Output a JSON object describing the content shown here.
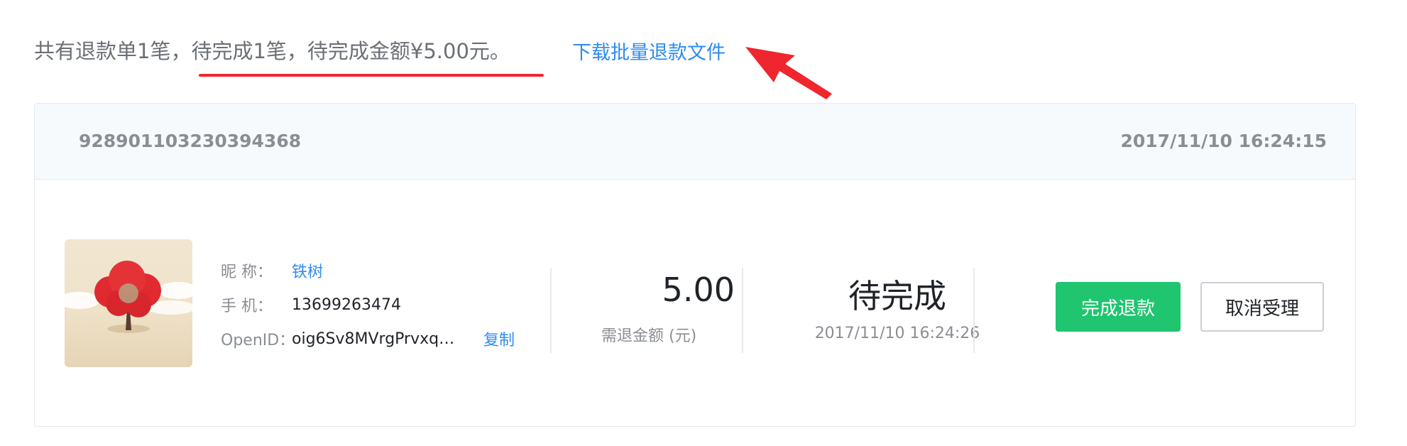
{
  "summary": {
    "prefix": "共有退款单1笔，",
    "highlight": "待完成1笔，待完成金额¥5.00元。",
    "download_link": "下载批量退款文件"
  },
  "order": {
    "order_no": "928901103230394368",
    "created_time": "2017/11/10 16:24:15",
    "user": {
      "nick_label": "昵    称：",
      "nick_value": "铁树",
      "phone_label": "手    机：",
      "phone_value": "13699263474",
      "openid_label": "OpenID：",
      "openid_value": "oig6Sv8MVrgPrvxq…",
      "copy_label": "复制"
    },
    "amount": "5.00",
    "amount_label": "需退金额 (元)",
    "status": "待完成",
    "status_time": "2017/11/10 16:24:26",
    "complete_button": "完成退款",
    "cancel_button": "取消受理"
  },
  "colors": {
    "accent_blue": "#2d8cf0",
    "success_green": "#1fc56f",
    "annotation_red": "#f0262e"
  },
  "icons": {
    "avatar": "red-tree-illustration",
    "annotation": "red-arrow-icon"
  }
}
